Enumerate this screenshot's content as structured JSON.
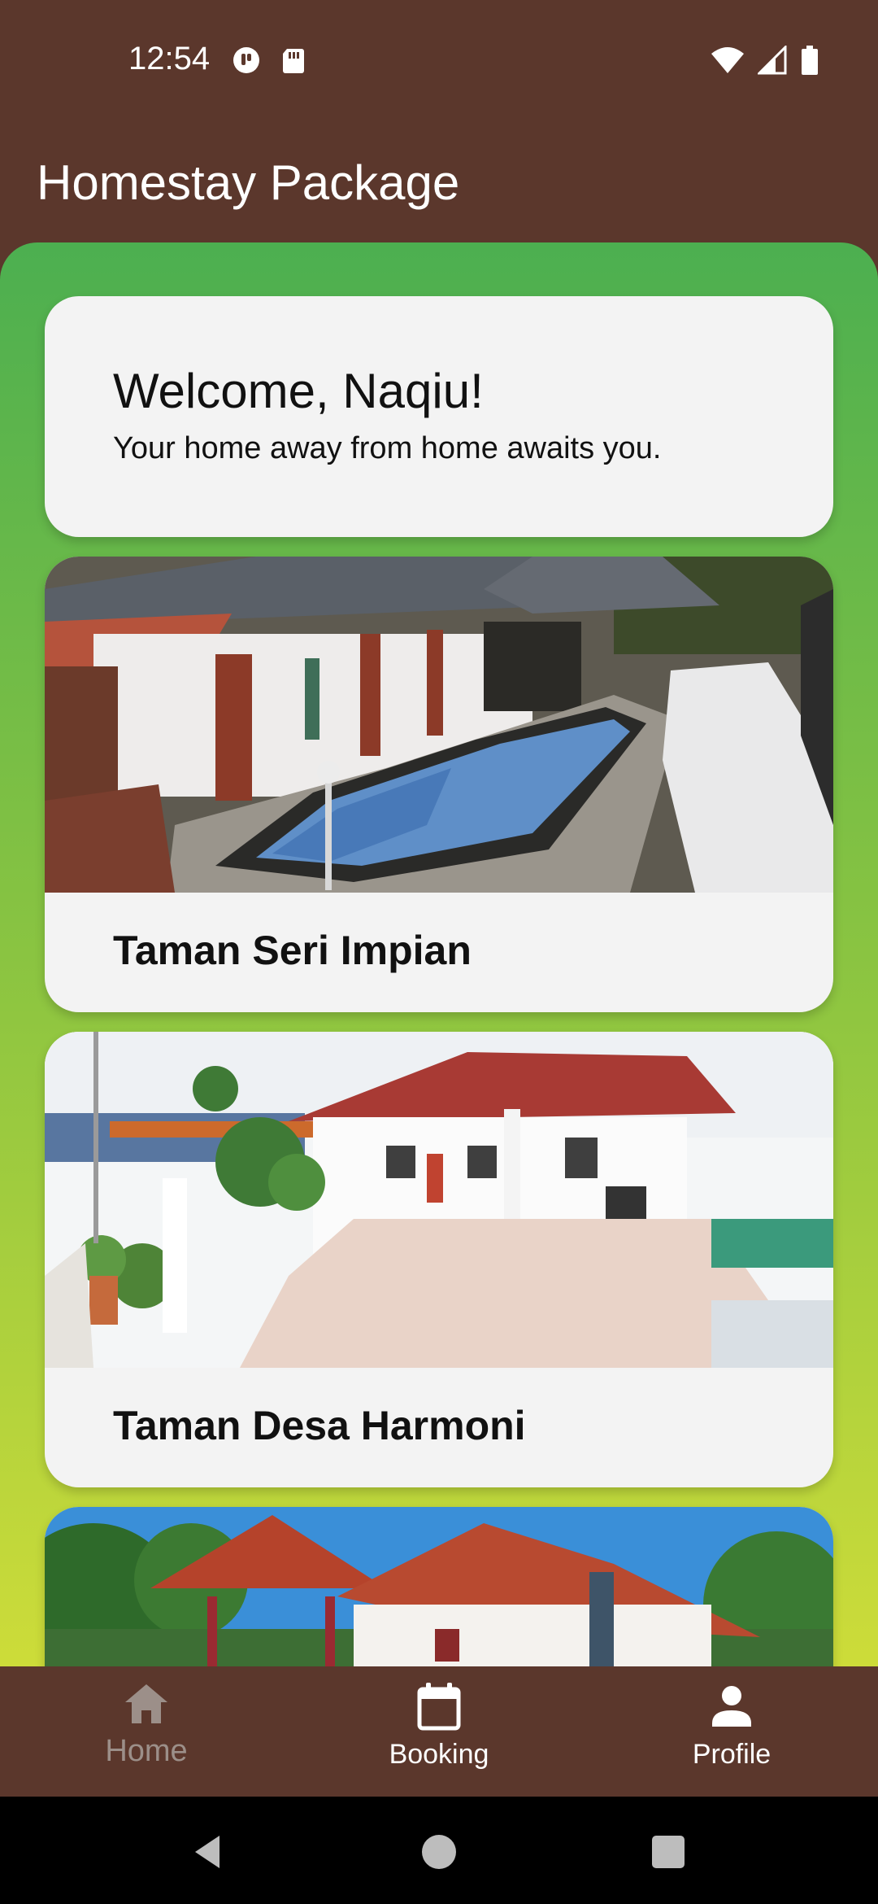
{
  "status_bar": {
    "time": "12:54",
    "left_icons": [
      "data-saver-icon",
      "sd-card-icon"
    ],
    "right_icons": [
      "wifi-icon",
      "signal-icon",
      "battery-icon"
    ]
  },
  "app_bar": {
    "title": "Homestay Package"
  },
  "welcome": {
    "title": "Welcome, Naqiu!",
    "subtitle": "Your home away from home awaits you."
  },
  "homestays": [
    {
      "name": "Taman Seri Impian",
      "image": "villa-with-pool-photo"
    },
    {
      "name": "Taman Desa Harmoni",
      "image": "white-bungalow-photo"
    },
    {
      "name": "",
      "image": "red-roof-house-photo"
    }
  ],
  "bottom_nav": {
    "home_label": "Home",
    "booking_label": "Booking",
    "profile_label": "Profile"
  },
  "colors": {
    "brand_brown": "#5b372c",
    "gradient_top": "#4caf50",
    "gradient_bottom": "#cddc39",
    "card_bg": "#f3f3f3",
    "inactive_nav": "#9c8f89"
  }
}
